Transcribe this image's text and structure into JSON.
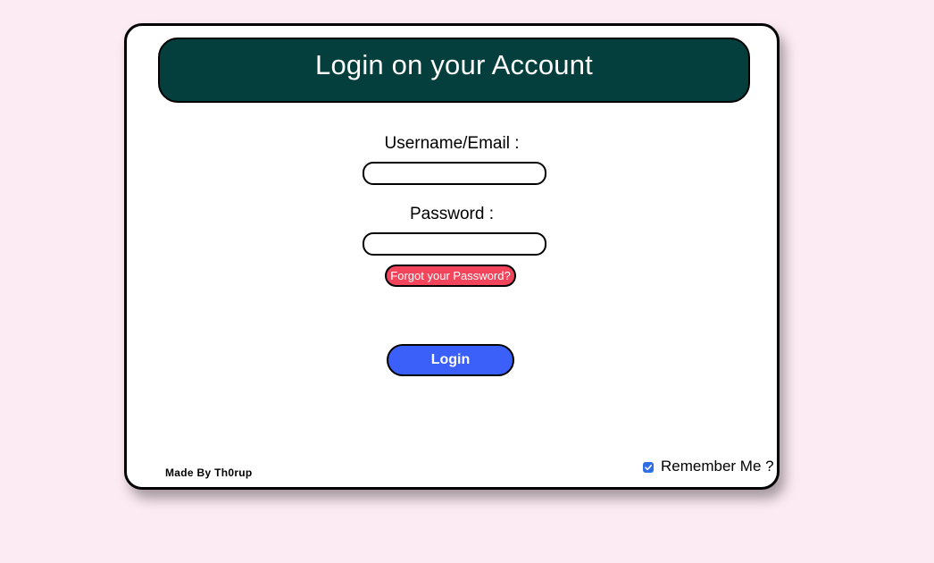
{
  "header": {
    "title": "Login on your Account"
  },
  "form": {
    "username_label": "Username/Email :",
    "username_value": "",
    "password_label": "Password :",
    "password_value": "",
    "forgot_label": "Forgot your Password?",
    "login_label": "Login"
  },
  "footer": {
    "credit": "Made By Th0rup",
    "remember_label": "Remember Me ?",
    "remember_checked": true
  },
  "icons": {
    "remember_checkbox": "checkmark-icon"
  },
  "colors": {
    "background": "#fdebf3",
    "header": "#053f3d",
    "forgot_button": "#f2455c",
    "login_button": "#3a60f9",
    "checkbox": "#2f6fe3"
  }
}
